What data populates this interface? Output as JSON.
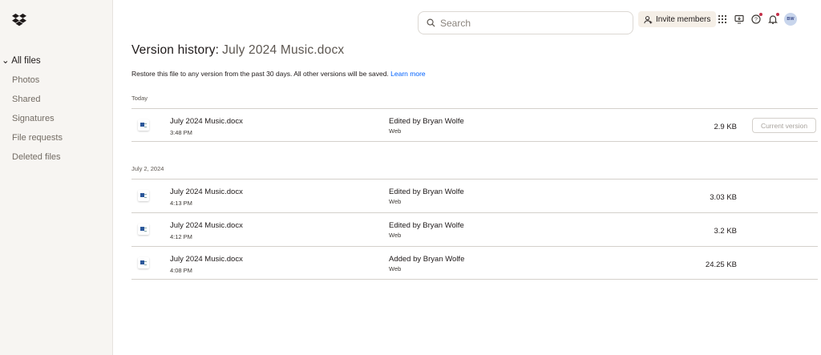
{
  "sidebar": {
    "items": [
      {
        "label": "All files"
      },
      {
        "label": "Photos"
      },
      {
        "label": "Shared"
      },
      {
        "label": "Signatures"
      },
      {
        "label": "File requests"
      },
      {
        "label": "Deleted files"
      }
    ]
  },
  "header": {
    "search_placeholder": "Search",
    "invite_label": "Invite members",
    "avatar_initials": "BW"
  },
  "page": {
    "title_prefix": "Version history:",
    "file_name": "July 2024 Music.docx",
    "description": "Restore this file to any version from the past 30 days. All other versions will be saved.",
    "learn_more": "Learn more"
  },
  "sections": [
    {
      "label": "Today",
      "versions": [
        {
          "name": "July 2024 Music.docx",
          "time": "3:48 PM",
          "editor": "Edited by Bryan Wolfe",
          "via": "Web",
          "size": "2.9 KB",
          "badge": "Current version"
        }
      ]
    },
    {
      "label": "July 2, 2024",
      "versions": [
        {
          "name": "July 2024 Music.docx",
          "time": "4:13 PM",
          "editor": "Edited by Bryan Wolfe",
          "via": "Web",
          "size": "3.03 KB"
        },
        {
          "name": "July 2024 Music.docx",
          "time": "4:12 PM",
          "editor": "Edited by Bryan Wolfe",
          "via": "Web",
          "size": "3.2 KB"
        },
        {
          "name": "July 2024 Music.docx",
          "time": "4:08 PM",
          "editor": "Added by Bryan Wolfe",
          "via": "Web",
          "size": "24.25 KB"
        }
      ]
    }
  ],
  "colors": {
    "link": "#0061fe",
    "notification_dot": "#c4304a",
    "invite_bg": "#f5efe7"
  }
}
